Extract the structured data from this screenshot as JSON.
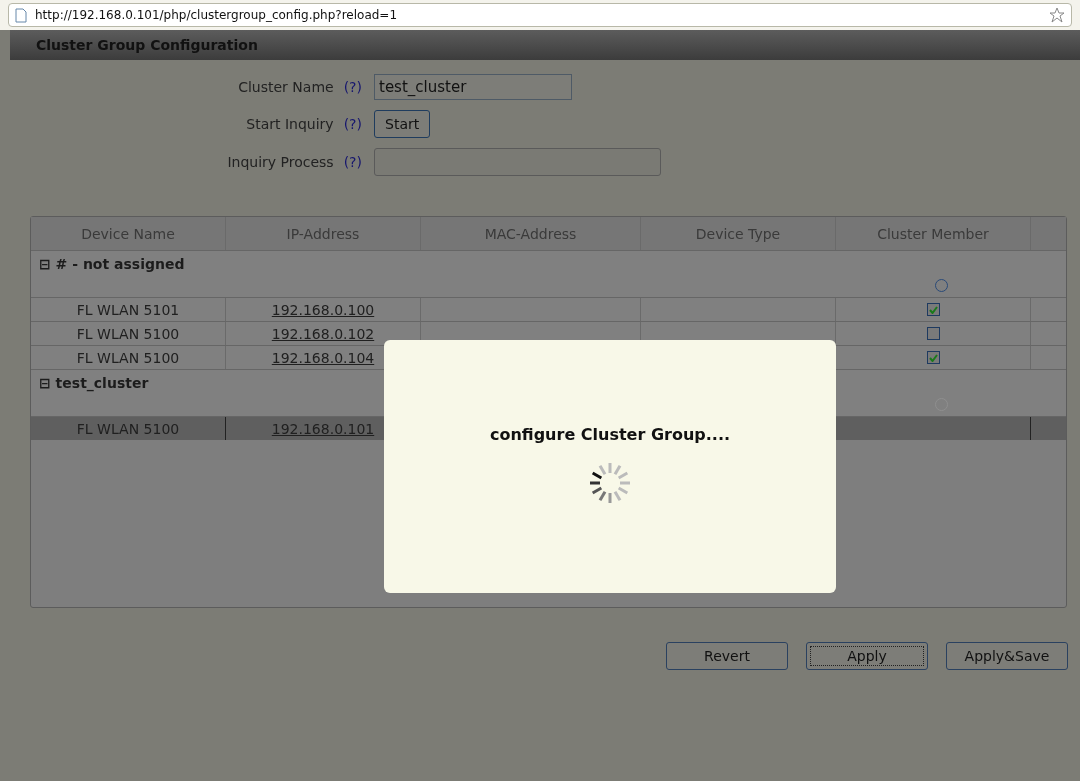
{
  "address_bar": {
    "url": "http://192.168.0.101/php/clustergroup_config.php?reload=1"
  },
  "page_title": "Cluster Group Configuration",
  "form": [
    {
      "kind": "text",
      "label": "Cluster Name",
      "help": "(?)",
      "value": "test_cluster"
    },
    {
      "kind": "button",
      "label": "Start Inquiry",
      "help": "(?)",
      "button": "Start"
    },
    {
      "kind": "progress",
      "label": "Inquiry Process",
      "help": "(?)",
      "level": 0
    }
  ],
  "table": {
    "columns": [
      "Device Name",
      "IP-Address",
      "MAC-Address",
      "Device Type",
      "Cluster Member"
    ],
    "groups": [
      {
        "toggle": "⊟",
        "name": "# - not assigned",
        "selected": false,
        "disabled": false,
        "rows": [
          {
            "device": "FL WLAN 5101",
            "ip": "192.168.0.100",
            "checked": true,
            "selected": false
          },
          {
            "device": "FL WLAN 5100",
            "ip": "192.168.0.102",
            "checked": false,
            "selected": false
          },
          {
            "device": "FL WLAN 5100",
            "ip": "192.168.0.104",
            "checked": true,
            "selected": false
          }
        ]
      },
      {
        "toggle": "⊟",
        "name": "test_cluster",
        "selected": false,
        "disabled": true,
        "rows": [
          {
            "device": "FL WLAN 5100",
            "ip": "192.168.0.101",
            "selected": true
          }
        ]
      }
    ]
  },
  "modal": {
    "message": "configure Cluster Group...."
  },
  "buttons": [
    {
      "label": "Revert",
      "focused": false
    },
    {
      "label": "Apply",
      "focused": true
    },
    {
      "label": "Apply&Save",
      "focused": false
    }
  ]
}
